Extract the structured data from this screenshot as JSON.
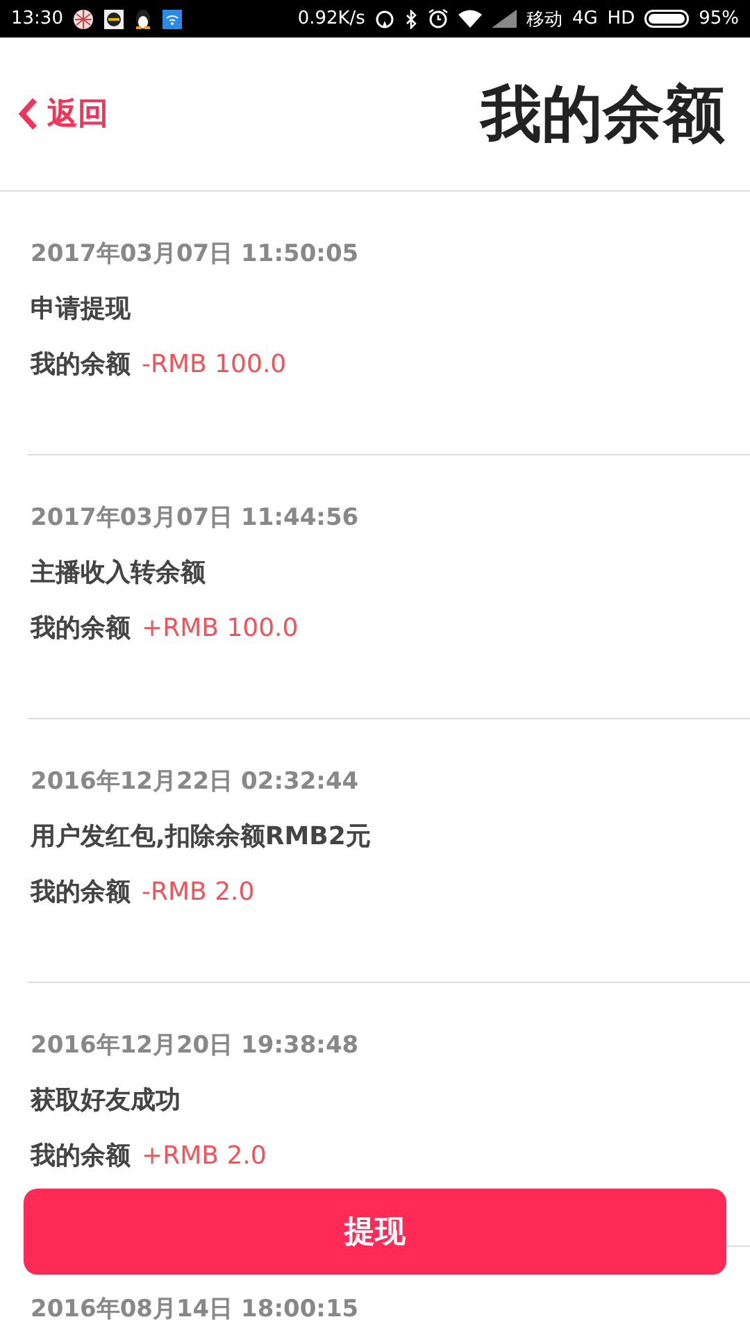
{
  "status_bar": {
    "time": "13:30",
    "speed": "0.92K/s",
    "carrier": "移动",
    "network": "4G",
    "hd": "HD",
    "battery": "95%"
  },
  "header": {
    "back": "返回",
    "title": "我的余额"
  },
  "records": [
    {
      "date": "2017年03月07日 11:50:05",
      "title": "申请提现",
      "label": "我的余额",
      "amount": "-RMB 100.0"
    },
    {
      "date": "2017年03月07日 11:44:56",
      "title": "主播收入转余额",
      "label": "我的余额",
      "amount": "+RMB 100.0"
    },
    {
      "date": "2016年12月22日 02:32:44",
      "title": "用户发红包,扣除余额RMB2元",
      "label": "我的余额",
      "amount": "-RMB 2.0"
    },
    {
      "date": "2016年12月20日 19:38:48",
      "title": "获取好友成功",
      "label": "我的余额",
      "amount": "+RMB 2.0"
    },
    {
      "date": "2016年08月14日 18:00:15"
    }
  ],
  "button": "提现"
}
